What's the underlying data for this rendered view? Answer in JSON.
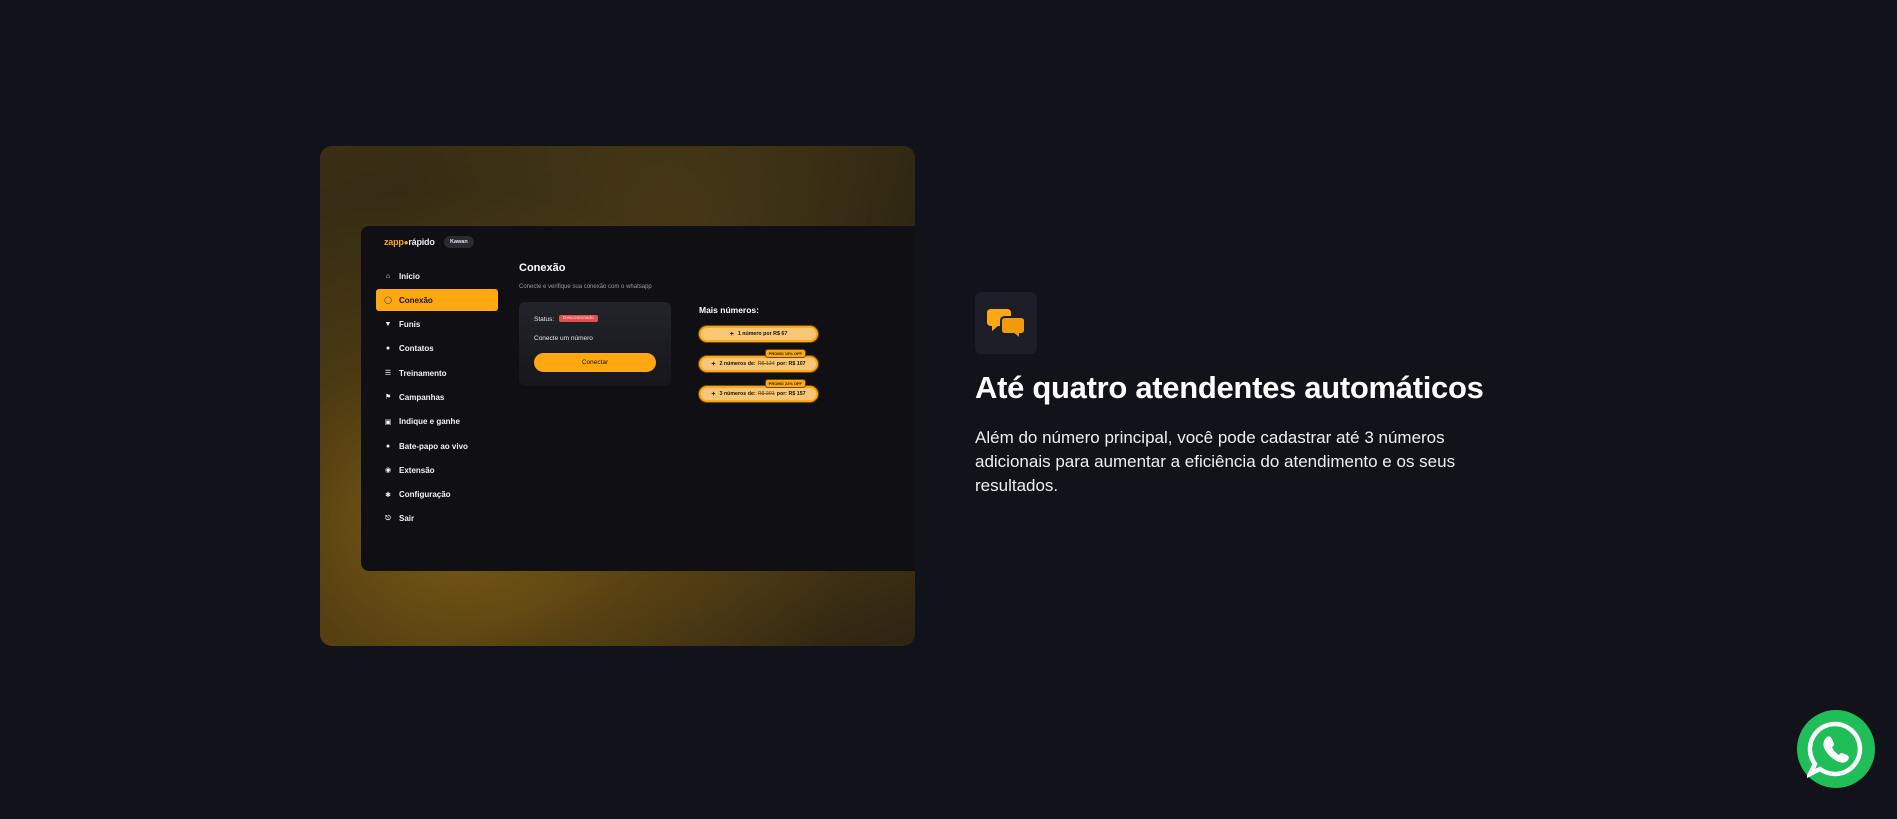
{
  "app": {
    "logo_left": "zapp",
    "logo_dot": "●",
    "logo_right": "rápido",
    "user_label": "Kawan",
    "nav": [
      {
        "label": "Início",
        "icon": "home-icon"
      },
      {
        "label": "Conexão",
        "icon": "whatsapp-icon",
        "active": true
      },
      {
        "label": "Funis",
        "icon": "filter-icon"
      },
      {
        "label": "Contatos",
        "icon": "users-icon"
      },
      {
        "label": "Treinamento",
        "icon": "training-icon"
      },
      {
        "label": "Campanhas",
        "icon": "flag-icon"
      },
      {
        "label": "Indique e ganhe",
        "icon": "gift-icon"
      },
      {
        "label": "Bate-papo ao vivo",
        "icon": "chat-icon"
      },
      {
        "label": "Extensão",
        "icon": "extension-icon"
      },
      {
        "label": "Configuração",
        "icon": "gear-icon"
      },
      {
        "label": "Sair",
        "icon": "logout-icon"
      }
    ],
    "content": {
      "title": "Conexão",
      "subtitle": "Conecte e verifique sua conexão com o whatsapp",
      "status_label": "Status:",
      "status_value": "Desconectado",
      "connect_prompt": "Conecte um número",
      "connect_button": "Conectar",
      "more_title": "Mais números:",
      "buttons": [
        {
          "plus": "+",
          "text": "1 número por R$ 67"
        },
        {
          "plus": "+",
          "text_a": "2 números de:",
          "old": "R$ 134",
          "text_b": "por: R$ 107",
          "promo": "PROMO 15% OFF"
        },
        {
          "plus": "+",
          "text_a": "3 números de:",
          "old": "R$ 201",
          "text_b": "por: R$ 157",
          "promo": "PROMO 22% OFF"
        }
      ]
    }
  },
  "feature": {
    "icon": "chat-bubbles-icon",
    "title": "Até quatro atendentes automáticos",
    "description": "Além do número principal, você pode cadastrar até 3 números adicionais para aumentar a eficiência do atendimento e os seus resultados."
  },
  "fab": {
    "icon": "whatsapp-icon"
  },
  "colors": {
    "accent": "#ffa812",
    "background": "#12121a",
    "whatsapp": "#1fbe58",
    "danger": "#e05050"
  }
}
